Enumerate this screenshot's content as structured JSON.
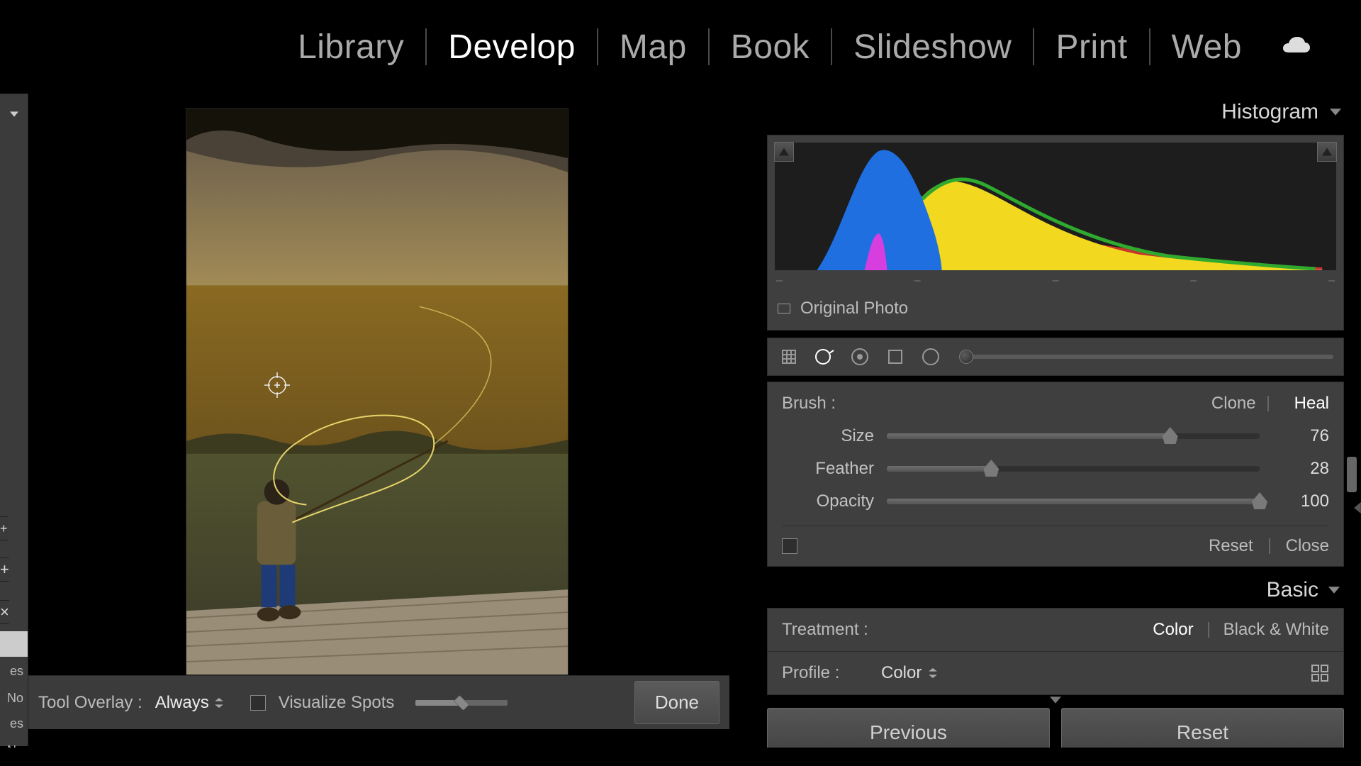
{
  "top_caret": "▲",
  "modules": [
    {
      "label": "Library",
      "active": false
    },
    {
      "label": "Develop",
      "active": true
    },
    {
      "label": "Map",
      "active": false
    },
    {
      "label": "Book",
      "active": false
    },
    {
      "label": "Slideshow",
      "active": false
    },
    {
      "label": "Print",
      "active": false
    },
    {
      "label": "Web",
      "active": false
    }
  ],
  "left_sliver": {
    "plus_small": "+",
    "plus": "+",
    "close": "×",
    "list": [
      "",
      "es",
      "No",
      "es",
      "No"
    ]
  },
  "canvas_toolbar": {
    "label": "Tool Overlay :",
    "value": "Always",
    "visualize": "Visualize Spots",
    "done": "Done"
  },
  "panels": {
    "histogram_title": "Histogram",
    "original_photo": "Original Photo",
    "ticks": [
      "–",
      "–",
      "–",
      "–",
      "–"
    ],
    "brush_label": "Brush :",
    "modes": {
      "clone": "Clone",
      "heal": "Heal",
      "active": "heal"
    },
    "sliders": [
      {
        "name": "Size",
        "value": 76,
        "max": 100
      },
      {
        "name": "Feather",
        "value": 28,
        "max": 100
      },
      {
        "name": "Opacity",
        "value": 100,
        "max": 100
      }
    ],
    "reset": "Reset",
    "close": "Close",
    "basic_title": "Basic",
    "treatment_label": "Treatment :",
    "treatment": {
      "color": "Color",
      "bw": "Black & White",
      "active": "color"
    },
    "profile_label": "Profile :",
    "profile_value": "Color",
    "previous": "Previous",
    "reset_btn": "Reset"
  }
}
